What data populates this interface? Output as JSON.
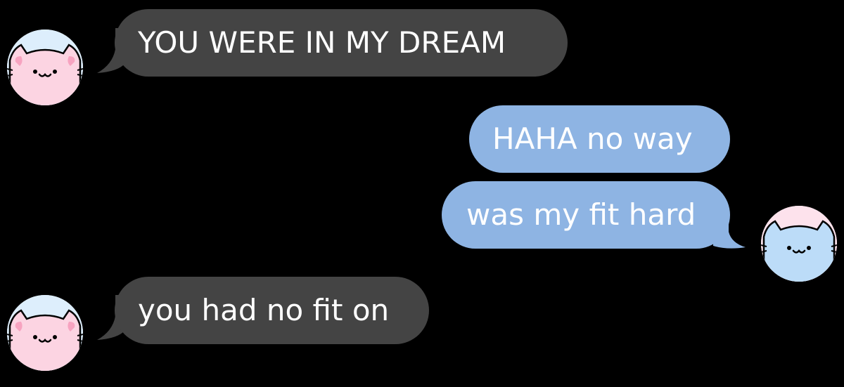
{
  "messages": [
    {
      "sender": "them",
      "text": "YOU WERE IN MY DREAM"
    },
    {
      "sender": "me",
      "text": "HAHA no way"
    },
    {
      "sender": "me",
      "text": "was my fit hard"
    },
    {
      "sender": "them",
      "text": "you had no fit on"
    }
  ],
  "avatars": {
    "them": {
      "icon": "pink-cat-icon"
    },
    "me": {
      "icon": "blue-cat-icon"
    }
  },
  "colors": {
    "background": "#000000",
    "incoming_bubble": "#444444",
    "outgoing_bubble": "#8eb4e3",
    "bubble_text": "#ffffff",
    "pink_cat": "#fcd4e2",
    "blue_cat": "#bcdcf8"
  }
}
